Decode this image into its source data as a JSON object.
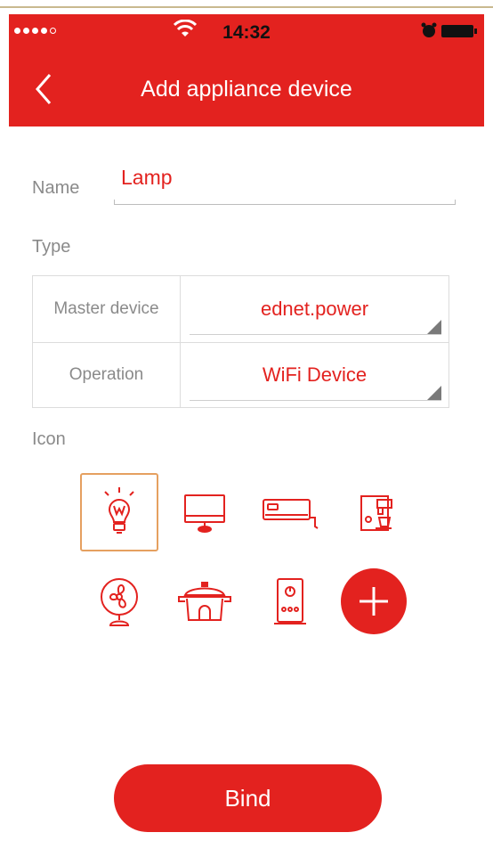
{
  "status_bar": {
    "time": "14:32",
    "signal_icon": "signal-dots-icon",
    "wifi_icon": "wifi-icon",
    "alarm_icon": "alarm-clock-icon",
    "battery_icon": "battery-icon"
  },
  "header": {
    "title": "Add appliance device",
    "back_icon": "chevron-left-icon",
    "background_color": "#e3221f"
  },
  "form": {
    "name_label": "Name",
    "name_value": "Lamp",
    "type_label": "Type",
    "type_rows": [
      {
        "label": "Master device",
        "value": "ednet.power"
      },
      {
        "label": "Operation",
        "value": "WiFi Device"
      }
    ],
    "icon_label": "Icon"
  },
  "icons": [
    {
      "name": "lamp-icon",
      "selected": true
    },
    {
      "name": "monitor-icon",
      "selected": false
    },
    {
      "name": "air-conditioner-icon",
      "selected": false
    },
    {
      "name": "coffee-machine-icon",
      "selected": false
    },
    {
      "name": "fan-icon",
      "selected": false
    },
    {
      "name": "rice-cooker-icon",
      "selected": false
    },
    {
      "name": "water-heater-icon",
      "selected": false
    },
    {
      "name": "add-icon",
      "selected": false
    }
  ],
  "actions": {
    "bind_label": "Bind"
  },
  "colors": {
    "accent": "#e3221f",
    "selected_border": "#e5a060",
    "label_gray": "#8a8a8a"
  }
}
